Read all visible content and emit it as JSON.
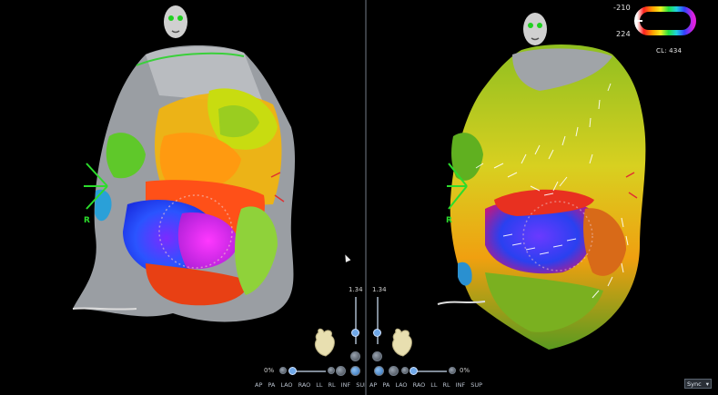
{
  "left": {
    "orientation_label": "R",
    "zoom_value": "1.34",
    "opacity_value": "0%",
    "views": [
      "AP",
      "PA",
      "LAO",
      "RAO",
      "LL",
      "RL",
      "INF",
      "SUP"
    ]
  },
  "right": {
    "orientation_label": "R",
    "zoom_value": "1.34",
    "opacity_value": "0%",
    "views": [
      "AP",
      "PA",
      "LAO",
      "RAO",
      "LL",
      "RL",
      "INF",
      "SUP"
    ],
    "legend": {
      "max": "-210",
      "min": "224",
      "cl_label": "CL: 434"
    }
  },
  "sync": {
    "label": "Sync"
  },
  "colors": {
    "background": "#000000",
    "divider": "#3a3e44",
    "orientation_green": "#2cdc2c",
    "marker_red": "#e03030",
    "accent_blue": "#6fa8e8"
  },
  "icons": [
    "head-orientation-icon",
    "heart-model-icon",
    "zoom-button-icon",
    "rotate-button-icon",
    "dropdown-chevron-icon"
  ]
}
